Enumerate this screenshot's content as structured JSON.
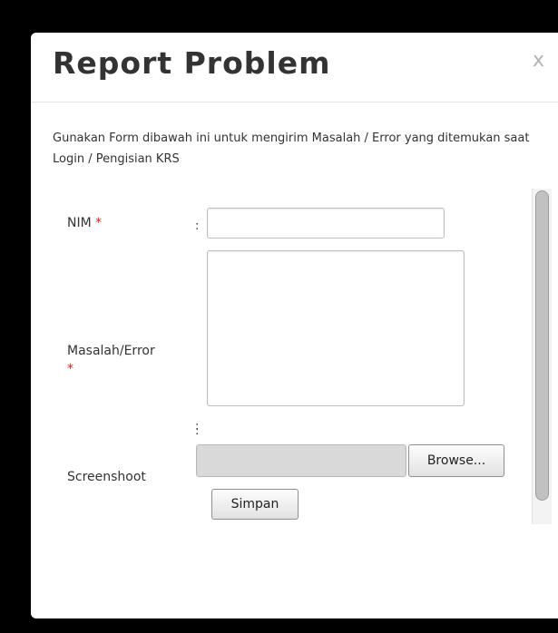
{
  "modal": {
    "title": "Report Problem",
    "close_label": "x",
    "intro_text": "Gunakan Form dibawah ini untuk mengirim Masalah / Error yang ditemukan saat Login / Pengisian KRS"
  },
  "form": {
    "required_marker": "*",
    "colon": ":",
    "nim": {
      "label": "NIM",
      "value": "",
      "placeholder": ""
    },
    "masalah": {
      "label": "Masalah/Error",
      "value": "",
      "placeholder": ""
    },
    "screenshot": {
      "label": "Screenshoot",
      "file_value": "",
      "browse_label": "Browse..."
    },
    "submit_label": "Simpan"
  },
  "colors": {
    "backdrop": "#000000",
    "required": "#e02020",
    "title": "#333333"
  },
  "icons": {
    "close": "close-icon",
    "resize": "resize-grip-icon"
  }
}
